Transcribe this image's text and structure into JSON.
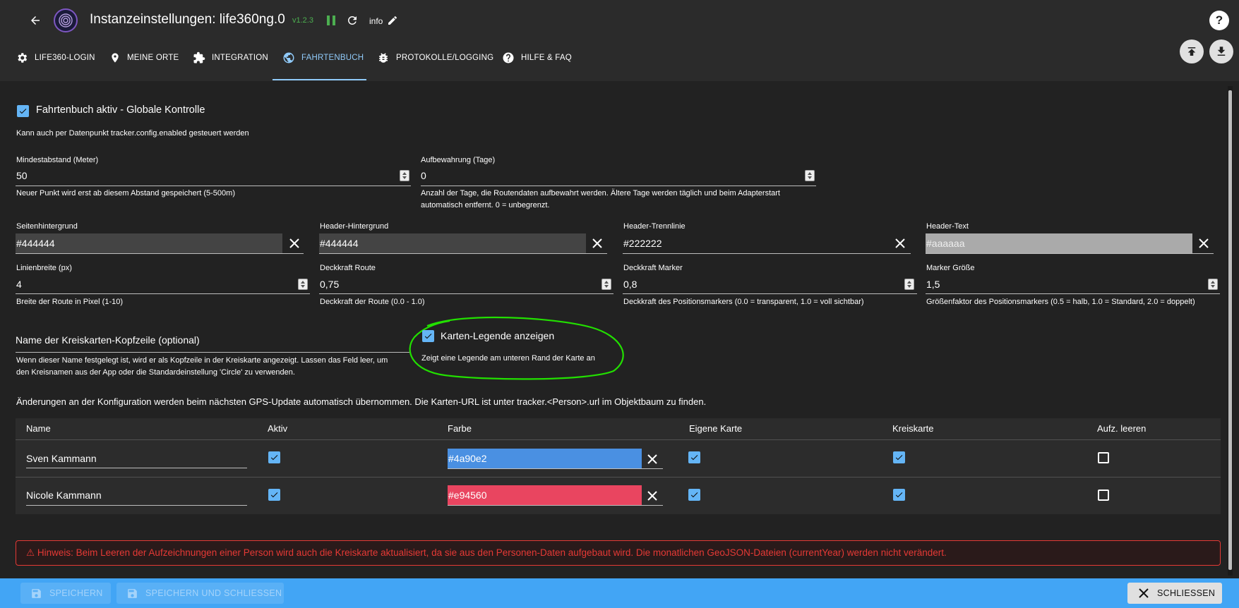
{
  "header": {
    "title": "Instanzeinstellungen: life360ng.0",
    "version": "v1.2.3",
    "info_label": "info"
  },
  "tabs": [
    {
      "label": "LIFE360-LOGIN"
    },
    {
      "label": "MEINE ORTE"
    },
    {
      "label": "INTEGRATION"
    },
    {
      "label": "FAHRTENBUCH"
    },
    {
      "label": "PROTOKOLLE/LOGGING"
    },
    {
      "label": "HILFE & FAQ"
    }
  ],
  "form": {
    "enable_label": "Fahrtenbuch aktiv - Globale Kontrolle",
    "enable_help": "Kann auch per Datenpunkt tracker.config.enabled gesteuert werden",
    "min_distance": {
      "label": "Mindestabstand (Meter)",
      "value": "50",
      "help": "Neuer Punkt wird erst ab diesem Abstand gespeichert (5-500m)"
    },
    "retention": {
      "label": "Aufbewahrung (Tage)",
      "value": "0",
      "help_1": "Anzahl der Tage, die Routendaten aufbewahrt werden. Ältere Tage werden täglich und beim Adapterstart",
      "help_2": "automatisch entfernt. 0 = unbegrenzt."
    },
    "page_bg": {
      "label": "Seitenhintergrund",
      "value": "#444444"
    },
    "header_bg": {
      "label": "Header-Hintergrund",
      "value": "#444444"
    },
    "header_divider": {
      "label": "Header-Trennlinie",
      "value": "#222222"
    },
    "header_text": {
      "label": "Header-Text",
      "value": "#aaaaaa"
    },
    "line_width": {
      "label": "Linienbreite (px)",
      "value": "4",
      "help": "Breite der Route in Pixel (1-10)"
    },
    "route_opacity": {
      "label": "Deckkraft Route",
      "value": "0,75",
      "help": "Deckkraft der Route (0.0 - 1.0)"
    },
    "marker_opacity": {
      "label": "Deckkraft Marker",
      "value": "0,8",
      "help": "Deckkraft des Positionsmarkers (0.0 = transparent, 1.0 = voll sichtbar)"
    },
    "marker_size": {
      "label": "Marker Größe",
      "value": "1,5",
      "help": "Größenfaktor des Positionsmarkers (0.5 = halb, 1.0 = Standard, 2.0 = doppelt)"
    },
    "circle_header": {
      "label": "Name der Kreiskarten-Kopfzeile (optional)",
      "help_1": "Wenn dieser Name festgelegt ist, wird er als Kopfzeile in der Kreiskarte angezeigt. Lassen das Feld leer, um",
      "help_2": "den Kreisnamen aus der App oder die Standardeinstellung 'Circle' zu verwenden."
    },
    "legend": {
      "label": "Karten-Legende anzeigen",
      "help": "Zeigt eine Legende am unteren Rand der Karte an"
    },
    "info_text": "Änderungen an der Konfiguration werden beim nächsten GPS-Update automatisch übernommen. Die Karten-URL ist unter tracker.<Person>.url im Objektbaum zu finden."
  },
  "table": {
    "headers": [
      "Name",
      "Aktiv",
      "Farbe",
      "Eigene Karte",
      "Kreiskarte",
      "Aufz. leeren"
    ],
    "rows": [
      {
        "name": "Sven Kammann",
        "color": "#4a90e2",
        "active": true,
        "own_map": true,
        "circle_map": true,
        "clear": false
      },
      {
        "name": "Nicole Kammann",
        "color": "#e94560",
        "active": true,
        "own_map": true,
        "circle_map": true,
        "clear": false
      }
    ]
  },
  "warning": "⚠ Hinweis: Beim Leeren der Aufzeichnungen einer Person wird auch die Kreiskarte aktualisiert, da sie aus den Personen-Daten aufgebaut wird. Die monatlichen GeoJSON-Dateien (currentYear) werden nicht verändert.",
  "footer": {
    "save": "SPEICHERN",
    "save_close": "SPEICHERN UND SCHLIESSEN",
    "close": "SCHLIESSEN"
  },
  "colors": {
    "accent": "#90caf9",
    "checkbox": "#64b5f6",
    "warning": "#e53935",
    "highlight_circle": "#22e000",
    "footer": "#42a5f5"
  }
}
